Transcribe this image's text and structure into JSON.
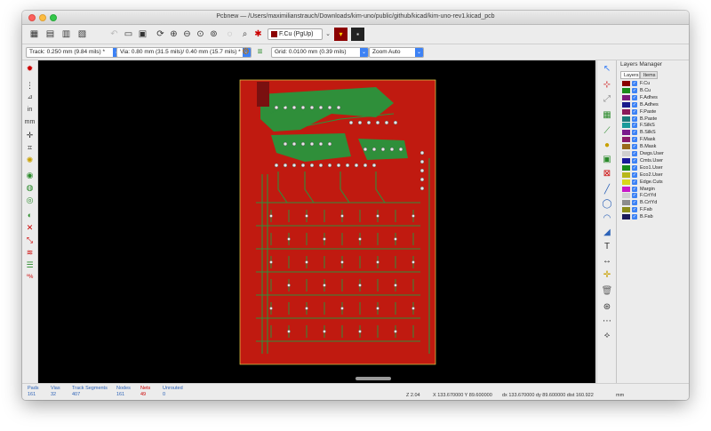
{
  "window": {
    "title": "Pcbnew — /Users/maximilianstrauch/Downloads/kim-uno/public/github/kicad/kim-uno-rev1.kicad_pcb"
  },
  "toolbar": {
    "active_layer": "F.Cu (PgUp)",
    "track": "Track: 0.250 mm (9.84 mils) *",
    "via": "Via: 0.80 mm (31.5 mils)/ 0.40 mm (15.7 mils) *",
    "grid": "Grid: 0.0100 mm (0.39 mils)",
    "zoom": "Zoom Auto"
  },
  "layers_manager": {
    "title": "Layers Manager",
    "tabs": [
      "Layers",
      "Items"
    ],
    "layers": [
      {
        "name": "F.Cu",
        "color": "#8b0000"
      },
      {
        "name": "B.Cu",
        "color": "#1a8c1a"
      },
      {
        "name": "F.Adhes",
        "color": "#7a1a7a"
      },
      {
        "name": "B.Adhes",
        "color": "#1a1a8c"
      },
      {
        "name": "F.Paste",
        "color": "#8c1a5a"
      },
      {
        "name": "B.Paste",
        "color": "#1a7a7a"
      },
      {
        "name": "F.SilkS",
        "color": "#1a9a9a"
      },
      {
        "name": "B.SilkS",
        "color": "#7a1a8c"
      },
      {
        "name": "F.Mask",
        "color": "#8c1a6a"
      },
      {
        "name": "B.Mask",
        "color": "#9a6a1a"
      },
      {
        "name": "Dwgs.User",
        "color": "#cfcfcf"
      },
      {
        "name": "Cmts.User",
        "color": "#1a1a9a"
      },
      {
        "name": "Eco1.User",
        "color": "#1a8c1a"
      },
      {
        "name": "Eco2.User",
        "color": "#b8b81a"
      },
      {
        "name": "Edge.Cuts",
        "color": "#d8d81a"
      },
      {
        "name": "Margin",
        "color": "#c81ac8"
      },
      {
        "name": "F.CrtYd",
        "color": "#d0d0d0"
      },
      {
        "name": "B.CrtYd",
        "color": "#8c8c8c"
      },
      {
        "name": "F.Fab",
        "color": "#8c8c1a"
      },
      {
        "name": "B.Fab",
        "color": "#1a1a5a"
      }
    ]
  },
  "status": {
    "pads_label": "Pads",
    "pads": "161",
    "vias_label": "Vias",
    "vias": "32",
    "tracks_label": "Track Segments",
    "tracks": "407",
    "nodes_label": "Nodes",
    "nodes": "161",
    "nets_label": "Nets",
    "nets": "49",
    "unrouted_label": "Unrouted",
    "unrouted": "0",
    "zoom": "Z 2.04",
    "xy": "X 133.670000  Y 89.600000",
    "dxy": "dx 133.670000  dy 89.600000  dist 160.922",
    "units": "mm"
  },
  "colors": {
    "board_copper": "#c01a10",
    "board_back": "#2f8f3a",
    "canvas": "#000000"
  }
}
